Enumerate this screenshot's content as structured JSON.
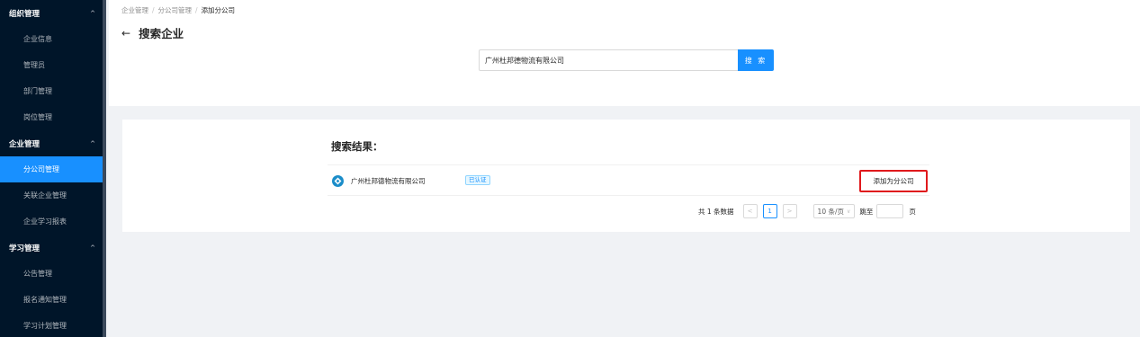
{
  "sidebar": {
    "groups": [
      {
        "label": "组织管理",
        "items": [
          "企业信息",
          "管理员",
          "部门管理",
          "岗位管理"
        ]
      },
      {
        "label": "企业管理",
        "items": [
          "分公司管理",
          "关联企业管理",
          "企业学习报表"
        ]
      },
      {
        "label": "学习管理",
        "items": [
          "公告管理",
          "报名通知管理",
          "学习计划管理"
        ]
      }
    ],
    "active_item": "分公司管理"
  },
  "breadcrumb": [
    "企业管理",
    "分公司管理",
    "添加分公司"
  ],
  "page_title": "搜索企业",
  "search": {
    "value": "广州杜邦德物流有限公司",
    "button_label": "搜 索"
  },
  "results": {
    "title": "搜索结果：",
    "items": [
      {
        "name": "广州杜邦德物流有限公司",
        "badge": "已认证",
        "action_label": "添加为分公司"
      }
    ]
  },
  "pagination": {
    "total_text": "共 1 条数据",
    "current_page": "1",
    "page_size": "10 条/页",
    "jump_label": "跳至",
    "page_unit": "页"
  },
  "colors": {
    "sidebar_bg": "#001529",
    "accent": "#1890ff",
    "highlight_border": "#e0191c"
  }
}
